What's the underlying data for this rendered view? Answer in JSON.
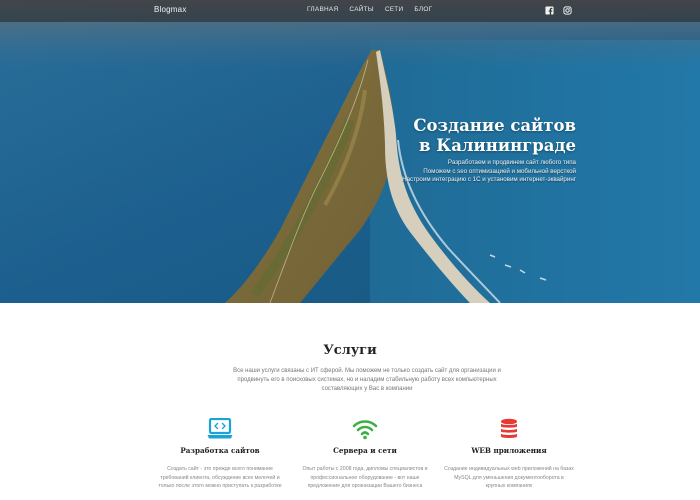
{
  "header": {
    "brand": "Blogmax",
    "nav": [
      "ГЛАВНАЯ",
      "САЙТЫ",
      "СЕТИ",
      "БЛОГ"
    ],
    "social_icons": [
      "facebook-icon",
      "instagram-icon"
    ]
  },
  "hero": {
    "title_line1": "Создание сайтов",
    "title_line2": "в Калининграде",
    "subtitle_line1": "Разработаем и продвинем сайт любого типа",
    "subtitle_line2": "Поможем с seo оптимизацией и мобильной версткой",
    "subtitle_line3": "Настроим интеграцию с 1С и установим интернет-эквайринг"
  },
  "services": {
    "title": "Услуги",
    "intro_line1": "Все наши услуги связаны с ИТ сферой. Мы поможем не только создать сайт для организации и",
    "intro_line2": "продвинуть его в поисковых системах, но и наладим стабильную работу всех компьютерных",
    "intro_line3": "составляющих у Вас в компании",
    "cards": [
      {
        "icon": "laptop-code-icon",
        "color": "#1ba3d8",
        "title": "Разработка сайтов",
        "line1": "Создать сайт - это прежде всего понимание",
        "line2": "требований клиента, обсуждение всех мелочей и",
        "line3": "только после этого можно приступать к разработке"
      },
      {
        "icon": "wifi-icon",
        "color": "#3cb043",
        "title": "Сервера и сети",
        "line1": "Опыт работы с 2008 года, дипломы специалистов и",
        "line2": "профессиональное оборудование - вот наше",
        "line3": "предложение для организации Вашего бизнеса"
      },
      {
        "icon": "database-icon",
        "color": "#e53935",
        "title": "WEB приложения",
        "line1": "Создание индивидуальных web приложений на базах",
        "line2": "MySQL для уменьшения документооборота в",
        "line3": "крупных компаниях"
      }
    ]
  }
}
